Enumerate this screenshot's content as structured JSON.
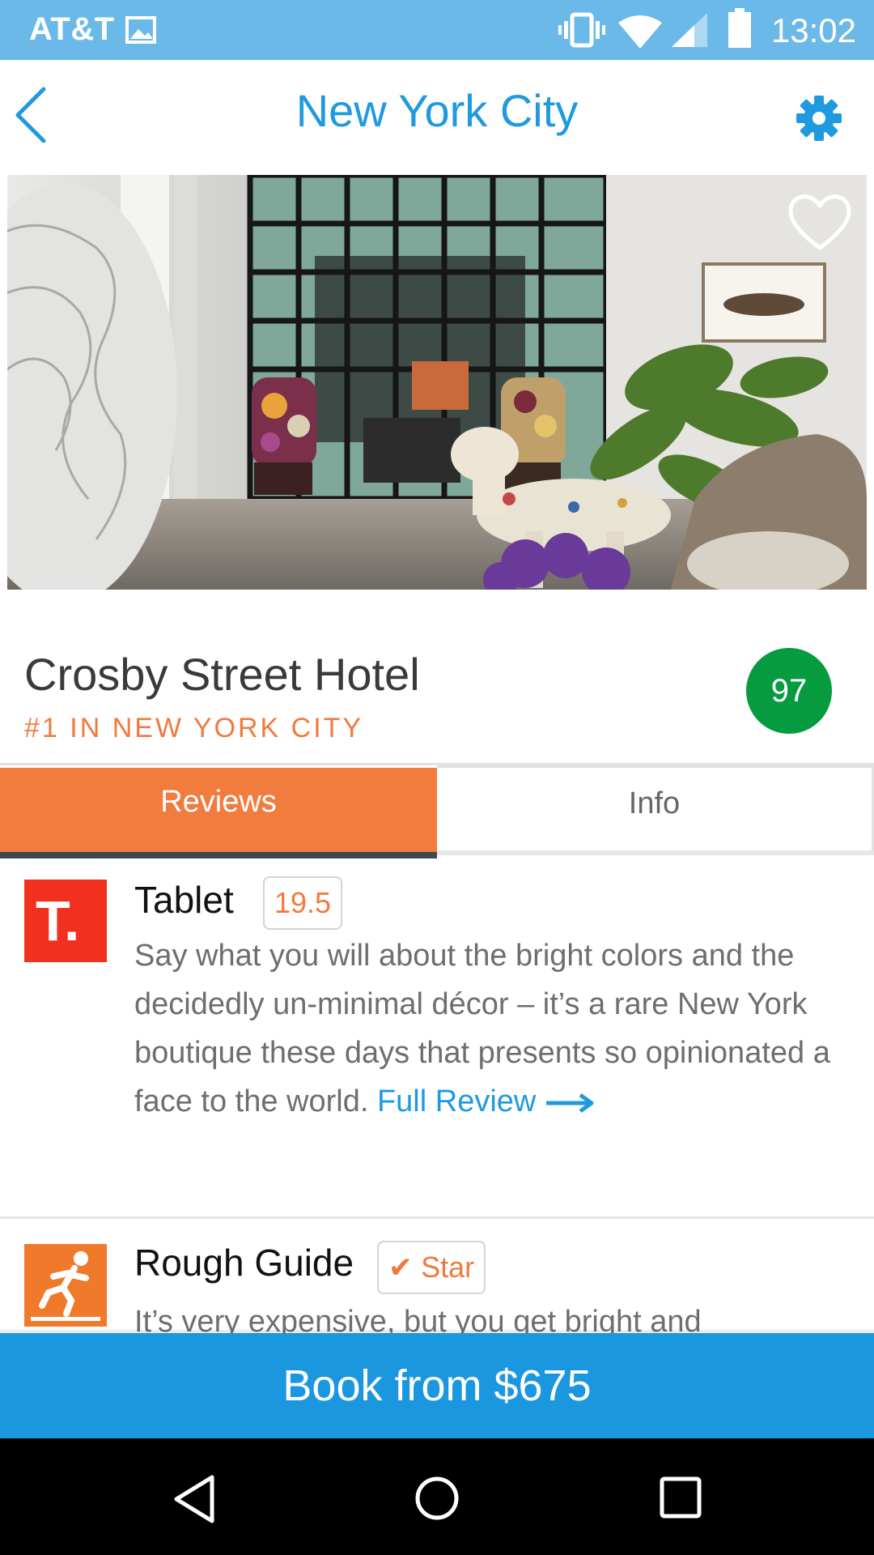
{
  "status_bar": {
    "carrier": "AT&T",
    "time": "13:02",
    "icons": [
      "image-icon",
      "vibrate-icon",
      "wifi-icon",
      "cell-signal-icon",
      "battery-icon"
    ]
  },
  "header": {
    "title": "New York City",
    "back_icon": "back-chevron-icon",
    "settings_icon": "gear-icon"
  },
  "hotel": {
    "name": "Crosby Street Hotel",
    "rank": "#1 IN NEW YORK CITY",
    "score": "97",
    "favorite_icon": "heart-outline-icon"
  },
  "tabs": {
    "reviews": "Reviews",
    "info": "Info"
  },
  "reviews": [
    {
      "source": "Tablet",
      "logo_text": "T.",
      "score": "19.5",
      "text": "Say what you will about the bright colors and the decidedly un-minimal décor – it’s a rare New York boutique these days that presents so opinionated a face to the world.",
      "link_label_1": "Full",
      "link_label_2": "Review"
    },
    {
      "source": "Rough Guide",
      "check_mark": "✔",
      "score": "Star",
      "text": "It’s very expensive, but you get bright and"
    }
  ],
  "book": {
    "label": "Book from $675"
  },
  "nav": {
    "back_icon": "nav-back-icon",
    "home_icon": "nav-home-icon",
    "recents_icon": "nav-recents-icon"
  },
  "colors": {
    "status_bar": "#6bb9e8",
    "accent_blue": "#1f9ae0",
    "accent_orange": "#f27b3e",
    "score_green": "#079b3f",
    "tablet_red": "#f0311e",
    "book_blue": "#1b97e0"
  }
}
